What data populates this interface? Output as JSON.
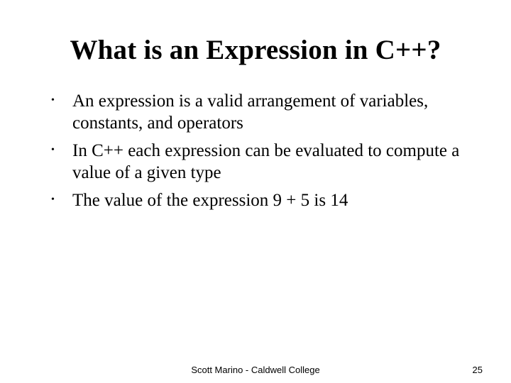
{
  "title": "What is an Expression in C++?",
  "bullets": {
    "0": "An expression is a valid arrangement of variables, constants, and operators",
    "1": "In C++ each expression can be evaluated to compute a value of a given type",
    "2": "The value of the expression 9 + 5 is 14"
  },
  "footer": {
    "center": "Scott Marino - Caldwell College",
    "page": "25"
  }
}
